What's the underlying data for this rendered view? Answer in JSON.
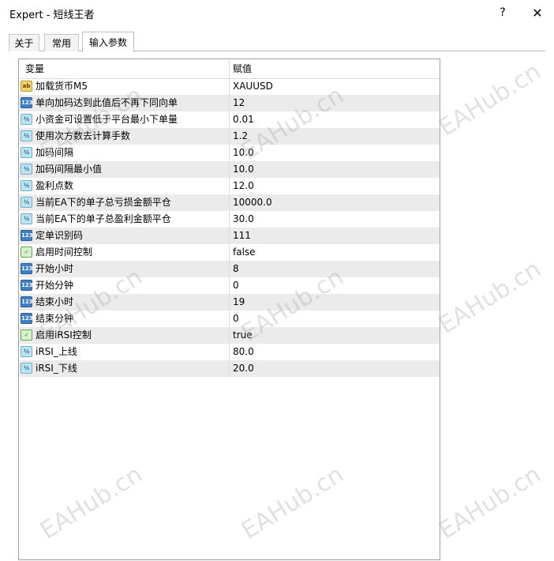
{
  "window": {
    "title": "Expert - 短线王者",
    "help_label": "?",
    "close_label": "✕"
  },
  "tabs": [
    {
      "label": "关于"
    },
    {
      "label": "常用"
    },
    {
      "label": "输入参数"
    }
  ],
  "grid": {
    "headers": {
      "variable": "变量",
      "value": "赋值"
    },
    "rows": [
      {
        "icon": "ab",
        "name": "加载货币M5",
        "value": "XAUUSD"
      },
      {
        "icon": "123",
        "name": "单向加码达到此值后不再下同向单",
        "value": "12"
      },
      {
        "icon": "1/2",
        "name": "小资金可设置低于平台最小下单量",
        "value": "0.01"
      },
      {
        "icon": "1/2",
        "name": "使用次方数去计算手数",
        "value": "1.2"
      },
      {
        "icon": "1/2",
        "name": "加码间隔",
        "value": "10.0"
      },
      {
        "icon": "1/2",
        "name": "加码间隔最小值",
        "value": "10.0"
      },
      {
        "icon": "1/2",
        "name": "盈利点数",
        "value": "12.0"
      },
      {
        "icon": "1/2",
        "name": "当前EA下的单子总亏损金额平仓",
        "value": "10000.0"
      },
      {
        "icon": "1/2",
        "name": "当前EA下的单子总盈利金额平仓",
        "value": "30.0"
      },
      {
        "icon": "123",
        "name": "定单识别码",
        "value": "111"
      },
      {
        "icon": "bool",
        "name": "启用时间控制",
        "value": "false"
      },
      {
        "icon": "123",
        "name": "开始小时",
        "value": "8"
      },
      {
        "icon": "123",
        "name": "开始分钟",
        "value": "0"
      },
      {
        "icon": "123",
        "name": "结束小时",
        "value": "19"
      },
      {
        "icon": "123",
        "name": "结束分钟",
        "value": "0"
      },
      {
        "icon": "bool",
        "name": "启用iRSI控制",
        "value": "true"
      },
      {
        "icon": "1/2",
        "name": "iRSI_上线",
        "value": "80.0"
      },
      {
        "icon": "1/2",
        "name": "iRSI_下线",
        "value": "20.0"
      }
    ]
  },
  "watermark": "EAHub.cn"
}
